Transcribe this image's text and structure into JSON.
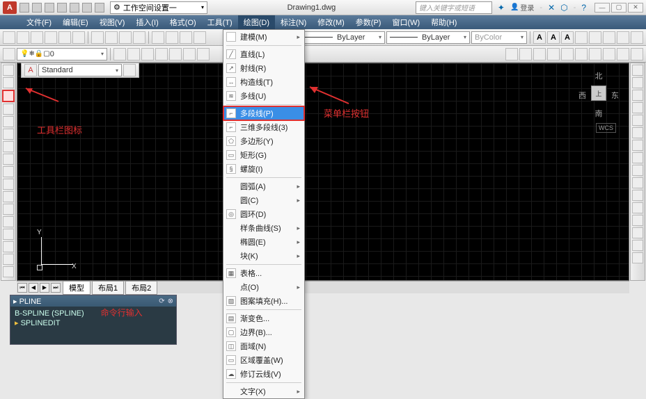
{
  "title": "Drawing1.dwg",
  "workspace_combo": "工作空间设置一",
  "search_placeholder": "键入关键字或短语",
  "login_label": "登录",
  "menus": [
    "文件(F)",
    "编辑(E)",
    "视图(V)",
    "插入(I)",
    "格式(O)",
    "工具(T)",
    "绘图(D)",
    "标注(N)",
    "修改(M)",
    "参数(P)",
    "窗口(W)",
    "帮助(H)"
  ],
  "open_menu_index": 6,
  "layer_combo": "0",
  "style_combo": "Standard",
  "linetype_combo": "ByLayer",
  "lineweight_combo": "ByLayer",
  "color_combo": "ByColor",
  "dropdown": [
    {
      "label": "建模(M)",
      "arrow": true,
      "ico": ""
    },
    "-",
    {
      "label": "直线(L)",
      "ico": "╱"
    },
    {
      "label": "射线(R)",
      "ico": "↗"
    },
    {
      "label": "构造线(T)",
      "ico": "↔"
    },
    {
      "label": "多线(U)",
      "ico": "≋"
    },
    "-",
    {
      "label": "多段线(P)",
      "ico": "⌐",
      "hl": true
    },
    {
      "label": "三维多段线(3)",
      "ico": "⌐"
    },
    {
      "label": "多边形(Y)",
      "ico": "⬠"
    },
    {
      "label": "矩形(G)",
      "ico": "▭"
    },
    {
      "label": "螺旋(I)",
      "ico": "§"
    },
    "-",
    {
      "label": "圆弧(A)",
      "arrow": true
    },
    {
      "label": "圆(C)",
      "arrow": true
    },
    {
      "label": "圆环(D)",
      "ico": "◎"
    },
    {
      "label": "样条曲线(S)",
      "arrow": true
    },
    {
      "label": "椭圆(E)",
      "arrow": true
    },
    {
      "label": "块(K)",
      "arrow": true
    },
    "-",
    {
      "label": "表格...",
      "ico": "▦"
    },
    {
      "label": "点(O)",
      "arrow": true
    },
    {
      "label": "图案填充(H)...",
      "ico": "▨"
    },
    "-",
    {
      "label": "渐变色...",
      "ico": "▤"
    },
    {
      "label": "边界(B)...",
      "ico": "▢"
    },
    {
      "label": "面域(N)",
      "ico": "◫"
    },
    {
      "label": "区域覆盖(W)",
      "ico": "▭"
    },
    {
      "label": "修订云线(V)",
      "ico": "☁"
    },
    "-",
    {
      "label": "文字(X)",
      "arrow": true
    }
  ],
  "viewcube": {
    "n": "北",
    "s": "南",
    "e": "东",
    "w": "西",
    "c": "上"
  },
  "wcs": "WCS",
  "ucs": {
    "x": "X",
    "y": "Y"
  },
  "annotations": {
    "toolbar_icon": "工具栏图标",
    "menu_button": "菜单栏按钮",
    "cmd_input": "命令行输入"
  },
  "tabs": {
    "model": "模型",
    "layout1": "布局1",
    "layout2": "布局2"
  },
  "cmd": {
    "title": "PLINE",
    "line1": "B-SPLINE (SPLINE)",
    "line2": "SPLINEDIT"
  }
}
